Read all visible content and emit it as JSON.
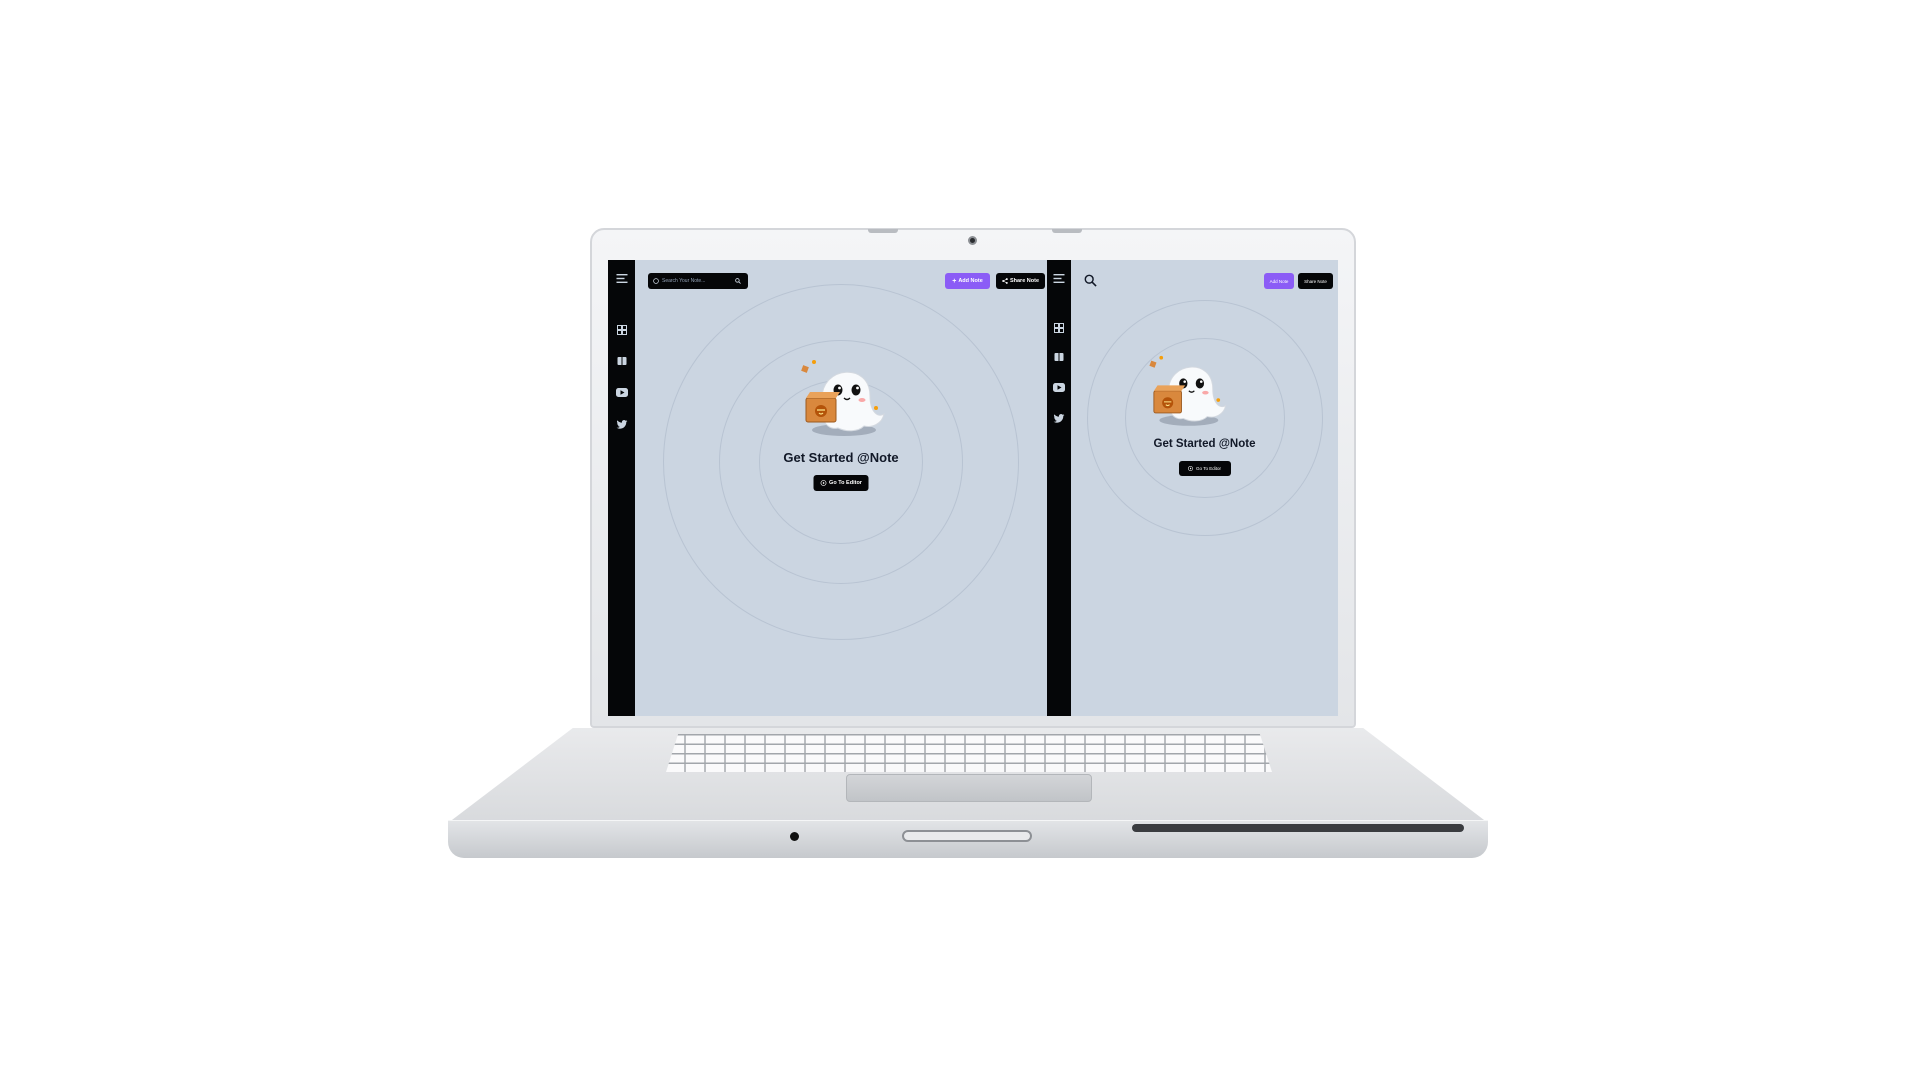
{
  "left_pane": {
    "search": {
      "placeholder": "Search Your Note..."
    },
    "add_note_label": "Add Note",
    "share_note_label": "Share Note",
    "title": "Get Started @Note",
    "go_to_editor_label": "Go To Editor",
    "sidebar_icons": [
      "menu-icon",
      "dashboard-icon",
      "book-icon",
      "youtube-icon",
      "twitter-icon"
    ]
  },
  "right_pane": {
    "add_note_label": "Add Note",
    "share_note_label": "Share Note",
    "title": "Get Started @Note",
    "go_to_editor_label": "Go To Editor",
    "sidebar_icons": [
      "menu-icon",
      "dashboard-icon",
      "book-icon",
      "youtube-icon",
      "twitter-icon"
    ]
  },
  "colors": {
    "accent": "#8b5cf6",
    "sidebar": "#050608",
    "canvas": "#cbd5e1"
  }
}
